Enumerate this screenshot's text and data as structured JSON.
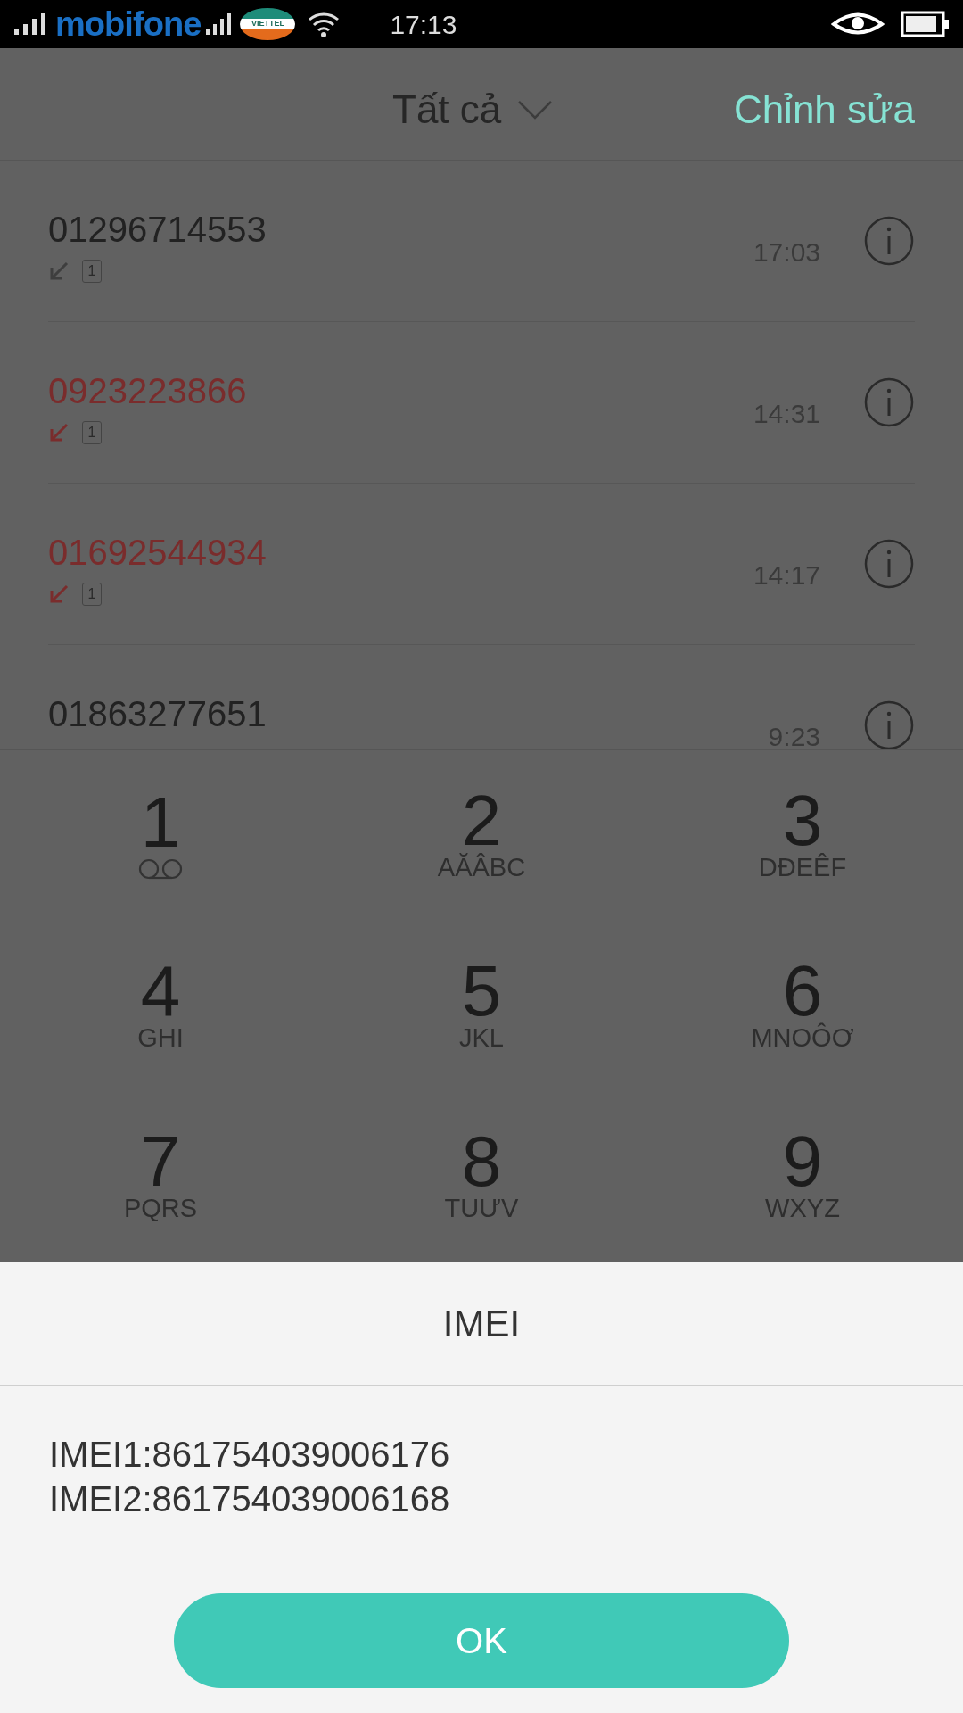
{
  "status_bar": {
    "carrier_1": "mobifone",
    "carrier_2": "VIETTEL",
    "time": "17:13"
  },
  "header": {
    "filter": "Tất cả",
    "edit": "Chỉnh sửa"
  },
  "calls": [
    {
      "number": "01296714553",
      "time": "17:03",
      "missed": false,
      "sim": "1"
    },
    {
      "number": "0923223866",
      "time": "14:31",
      "missed": true,
      "sim": "1"
    },
    {
      "number": "01692544934",
      "time": "14:17",
      "missed": true,
      "sim": "1"
    },
    {
      "number": "01863277651",
      "time": "9:23",
      "missed": false
    }
  ],
  "keypad": [
    {
      "digit": "1",
      "kind": "voicemail"
    },
    {
      "digit": "2",
      "kind": "letters",
      "letters": "AĂÂBC"
    },
    {
      "digit": "3",
      "kind": "letters",
      "letters": "DĐEÊF"
    },
    {
      "digit": "4",
      "kind": "letters",
      "letters": "GHI"
    },
    {
      "digit": "5",
      "kind": "letters",
      "letters": "JKL"
    },
    {
      "digit": "6",
      "kind": "letters",
      "letters": "MNOÔƠ"
    },
    {
      "digit": "7",
      "kind": "letters",
      "letters": "PQRS"
    },
    {
      "digit": "8",
      "kind": "letters",
      "letters": "TUƯV"
    },
    {
      "digit": "9",
      "kind": "letters",
      "letters": "WXYZ"
    }
  ],
  "dialog": {
    "title": "IMEI",
    "lines": [
      "IMEI1:861754039006176",
      "IMEI2:861754039006168"
    ],
    "button": "OK"
  }
}
